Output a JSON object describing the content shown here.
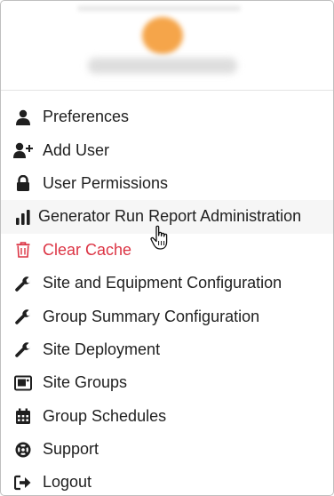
{
  "menu": {
    "items": [
      {
        "label": "Preferences",
        "icon": "user-icon"
      },
      {
        "label": "Add User",
        "icon": "user-plus-icon"
      },
      {
        "label": "User Permissions",
        "icon": "lock-icon"
      },
      {
        "label": "Generator Run Report Administration",
        "icon": "bar-chart-icon"
      },
      {
        "label": "Clear Cache",
        "icon": "trash-icon"
      },
      {
        "label": "Site and Equipment Configuration",
        "icon": "wrench-icon"
      },
      {
        "label": "Group Summary Configuration",
        "icon": "wrench-icon"
      },
      {
        "label": "Site Deployment",
        "icon": "wrench-icon"
      },
      {
        "label": "Site Groups",
        "icon": "image-icon"
      },
      {
        "label": "Group Schedules",
        "icon": "calendar-icon"
      },
      {
        "label": "Support",
        "icon": "life-ring-icon"
      },
      {
        "label": "Logout",
        "icon": "sign-out-icon"
      }
    ]
  },
  "colors": {
    "text": "#1f1f1f",
    "danger": "#dc3545",
    "avatar": "#f5a54a",
    "hover": "#f6f6f6"
  }
}
